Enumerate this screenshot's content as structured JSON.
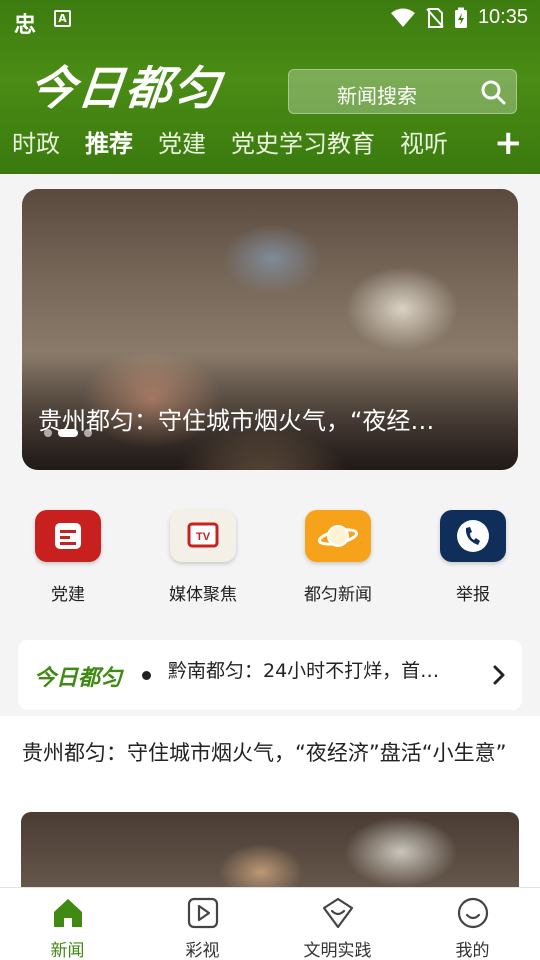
{
  "status_bar": {
    "time": "10:35",
    "left_icon_1": "忠",
    "left_icon_2": "A"
  },
  "header": {
    "logo": "今日都匀",
    "search_label": "新闻搜索",
    "tabs": [
      {
        "label": "时政",
        "active": false
      },
      {
        "label": "推荐",
        "active": true
      },
      {
        "label": "党建",
        "active": false
      },
      {
        "label": "党史学习教育",
        "active": false
      },
      {
        "label": "视听",
        "active": false
      }
    ],
    "add_label": "+"
  },
  "banner": {
    "title": "贵州都匀：守住城市烟火气，“夜经…",
    "slide_index": 2,
    "slide_count": 3
  },
  "quick_links": [
    {
      "label": "党建",
      "icon": "party-building-icon",
      "color": "#c8201e"
    },
    {
      "label": "媒体聚焦",
      "icon": "tv-icon",
      "color": "#f4f0e8"
    },
    {
      "label": "都匀新闻",
      "icon": "planet-icon",
      "color": "#f6a31b"
    },
    {
      "label": "举报",
      "icon": "phone-icon",
      "color": "#0f2e5a"
    }
  ],
  "ticker": {
    "logo": "今日都匀",
    "text": "黔南都匀：24小时不打烊，首…"
  },
  "article": {
    "title": "贵州都匀：守住城市烟火气，“夜经济”盘活“小生意”"
  },
  "bottom_nav": [
    {
      "label": "新闻",
      "active": true,
      "icon": "home-icon"
    },
    {
      "label": "彩视",
      "active": false,
      "icon": "video-icon"
    },
    {
      "label": "文明实践",
      "active": false,
      "icon": "heart-shield-icon"
    },
    {
      "label": "我的",
      "active": false,
      "icon": "smiley-icon"
    }
  ],
  "colors": {
    "brand_green": "#3f8a12",
    "header_green": "#4a8c15"
  }
}
